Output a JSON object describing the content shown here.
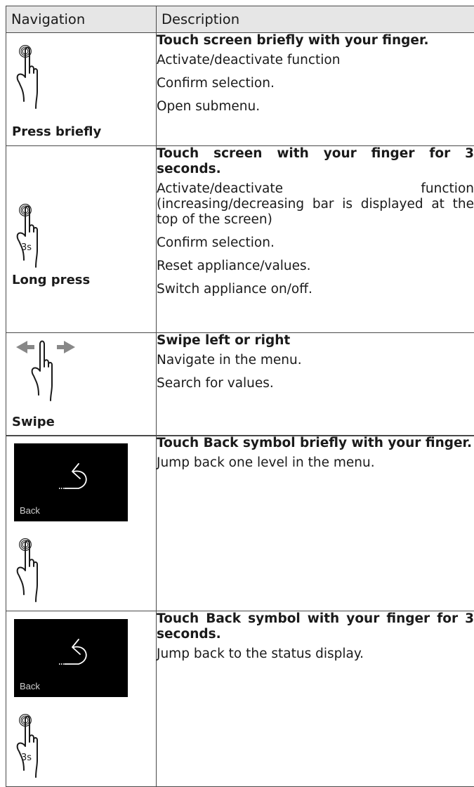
{
  "header": {
    "col1": "Navigation",
    "col2": "Description"
  },
  "rows": [
    {
      "nav_label": "Press briefly",
      "icon": "tap-hand-icon",
      "title": "Touch screen briefly with your finger.",
      "lines": [
        "Activate/deactivate function",
        "Confirm selection.",
        "Open submenu."
      ]
    },
    {
      "nav_label": "Long press",
      "icon": "long-press-hand-icon",
      "icon_text": "3s",
      "title": "Touch screen with your finger for 3 seconds.",
      "lines": [
        "Activate/deactivate function (increasing/decreasing bar is displayed at the top of the screen)",
        "Confirm selection.",
        "Reset appliance/values.",
        "Switch appliance on/off."
      ]
    },
    {
      "nav_label": "Swipe",
      "icon": "swipe-hand-icon",
      "title": "Swipe left or right",
      "lines": [
        "Navigate in the menu.",
        "Search for values."
      ]
    }
  ],
  "back_rows": [
    {
      "screen_label": "Back",
      "icon": "tap-hand-icon",
      "title": "Touch Back symbol briefly with your finger.",
      "lines": [
        "Jump back one level in the menu."
      ]
    },
    {
      "screen_label": "Back",
      "icon": "long-press-hand-icon",
      "icon_text": "3s",
      "title": "Touch Back symbol with your finger for 3 seconds.",
      "lines": [
        "Jump back to the status display."
      ]
    }
  ]
}
